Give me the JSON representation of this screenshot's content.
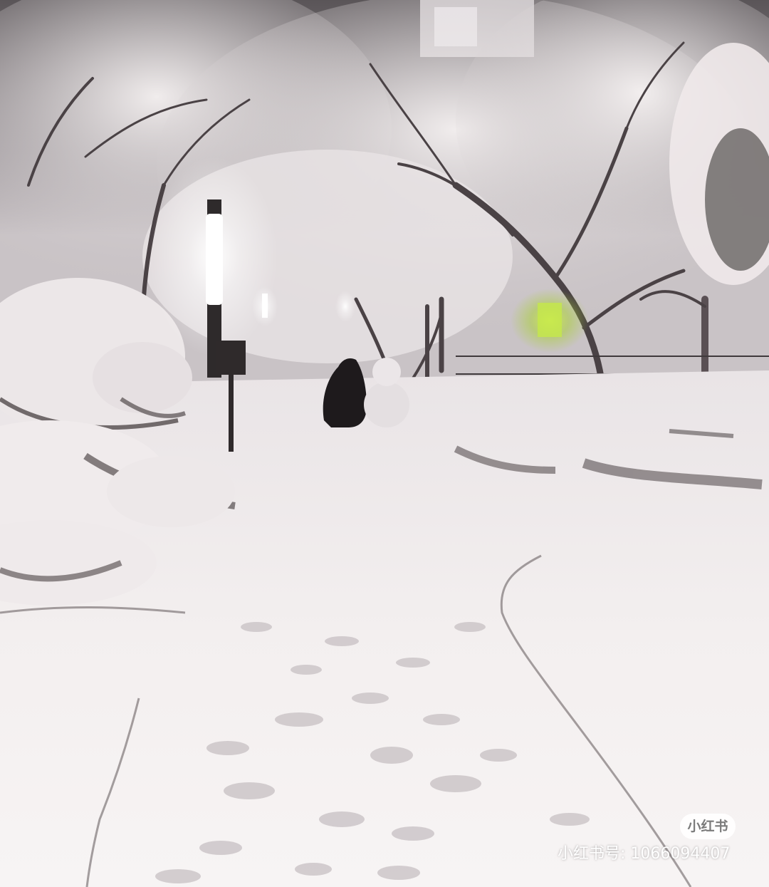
{
  "scene": {
    "subject": "snowy-park-path-at-night",
    "colors": {
      "snow": "#f4f0f0",
      "shadow": "#3a3435",
      "sky": "#8e8a90",
      "lamp": "#ffffff",
      "window": "#b8e03a"
    }
  },
  "watermark": {
    "badge": "小红书",
    "id_line": "小红书号: 1066094407"
  }
}
